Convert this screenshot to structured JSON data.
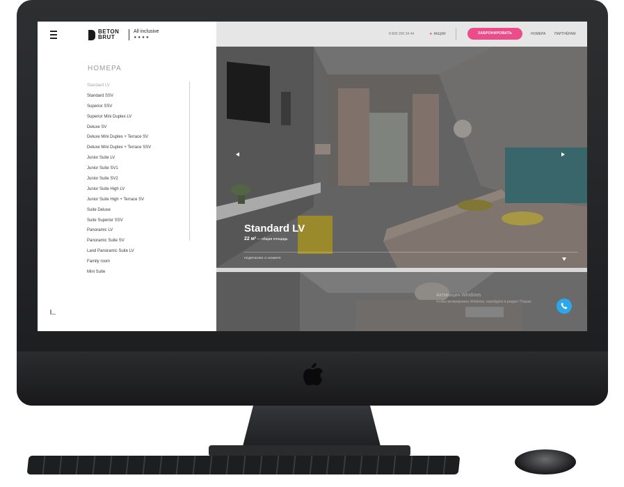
{
  "brand": {
    "name_line1": "BETON",
    "name_line2": "BRUT",
    "tagline": "All inclusive",
    "stars": "★ ★ ★ ★"
  },
  "header": {
    "phone": "8 800 200 34 44",
    "promo_label": "АКЦИИ",
    "book_button": "ЗАБРОНИРОВАТЬ",
    "nav": [
      "НОМЕРА",
      "ПАРТНЁРАМ"
    ]
  },
  "sidebar": {
    "title": "НОМЕРА",
    "rooms": [
      "Standard LV",
      "Standard SSV",
      "Superior SSV",
      "Superior Mini Duplex LV",
      "Deluxe SV",
      "Deluxe Mini Duplex + Terrace SV",
      "Deluxe Mini Duplex + Terrace SSV",
      "Junior Suite LV",
      "Junior Suite SV1",
      "Junior Suite SV2",
      "Junior Suite High LV",
      "Junior Suite High + Terrace SV",
      "Suite Deluxe",
      "Suite Superior SSV",
      "Panoramic LV",
      "Panoramic Suite SV",
      "Land Panoramic Suite LV",
      "Family room",
      "Mini Suite"
    ],
    "active_index": 0
  },
  "slide": {
    "title": "Standard LV",
    "area_value": "22 м²",
    "area_caption": "— общая площадь",
    "more_link": "ПОДРОБНЕЕ О НОМЕРЕ"
  },
  "watermark": {
    "line1": "Активация Windows",
    "line2": "Чтобы активировать Windows, перейдите в раздел \"Парам"
  },
  "colors": {
    "accent": "#ec4d8a",
    "call_button": "#2ea6ea"
  }
}
